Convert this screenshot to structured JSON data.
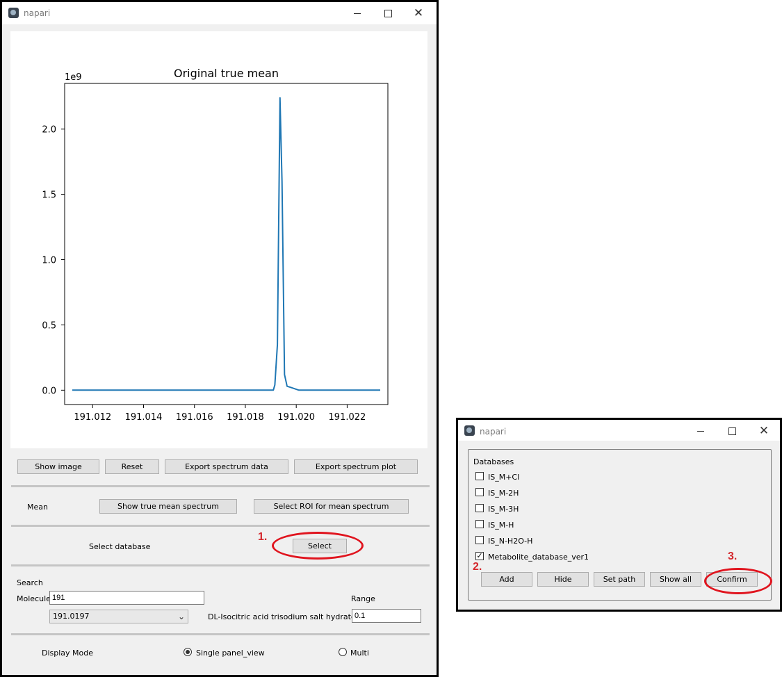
{
  "main_window": {
    "title": "napari",
    "controls": {
      "minimize": "—",
      "maximize": "☐",
      "close": "✕"
    },
    "chart_data": {
      "type": "line",
      "title": "Original true mean",
      "y_offset_label": "1e9",
      "xlabel": "",
      "ylabel": "",
      "xlim": [
        191.0109,
        191.0236
      ],
      "ylim": [
        -0.11,
        2.35
      ],
      "x_ticks": [
        191.012,
        191.014,
        191.016,
        191.018,
        191.02,
        191.022
      ],
      "x_tick_labels": [
        "191.012",
        "191.014",
        "191.016",
        "191.018",
        "191.020",
        "191.022"
      ],
      "y_ticks": [
        0.0,
        0.5,
        1.0,
        1.5,
        2.0
      ],
      "y_tick_labels": [
        "0.0",
        "0.5",
        "1.0",
        "1.5",
        "2.0"
      ],
      "grid": false,
      "color": "#1f77b4",
      "x": [
        191.0112,
        191.0191,
        191.01916,
        191.01926,
        191.01936,
        191.01944,
        191.01954,
        191.01964,
        191.0198,
        191.0201,
        191.0233
      ],
      "y": [
        0.0,
        0.0,
        0.04,
        0.35,
        2.24,
        1.6,
        0.12,
        0.03,
        0.02,
        0.0,
        0.0
      ]
    },
    "toolbar": {
      "show_image": "Show image",
      "reset": "Reset",
      "export_data": "Export spectrum data",
      "export_plot": "Export spectrum plot"
    },
    "mean": {
      "label": "Mean",
      "show_true": "Show true mean spectrum",
      "select_roi": "Select ROI for mean spectrum"
    },
    "database": {
      "label": "Select database",
      "select_button": "Select"
    },
    "search": {
      "header": "Search",
      "molecule_label": "Molecule",
      "molecule_value": "191",
      "range_label": "Range",
      "match_value": "191.0197",
      "match_name": "DL-Isocitric acid trisodium salt hydrate",
      "range_value": "0.1"
    },
    "display": {
      "label": "Display Mode",
      "single": "Single panel_view",
      "multi": "Multi"
    }
  },
  "db_window": {
    "title": "napari",
    "controls": {
      "minimize": "—",
      "maximize": "☐",
      "close": "✕"
    },
    "group_title": "Databases",
    "items": [
      {
        "label": "IS_M+Cl",
        "checked": false
      },
      {
        "label": "IS_M-2H",
        "checked": false
      },
      {
        "label": "IS_M-3H",
        "checked": false
      },
      {
        "label": "IS_M-H",
        "checked": false
      },
      {
        "label": "IS_N-H2O-H",
        "checked": false
      },
      {
        "label": "Metabolite_database_ver1",
        "checked": true
      }
    ],
    "buttons": {
      "add": "Add",
      "hide": "Hide",
      "set_path": "Set path",
      "show_all": "Show all",
      "confirm": "Confirm"
    }
  },
  "annotations": {
    "step1": "1.",
    "step2": "2.",
    "step3": "3.",
    "color": "#e0141e"
  }
}
